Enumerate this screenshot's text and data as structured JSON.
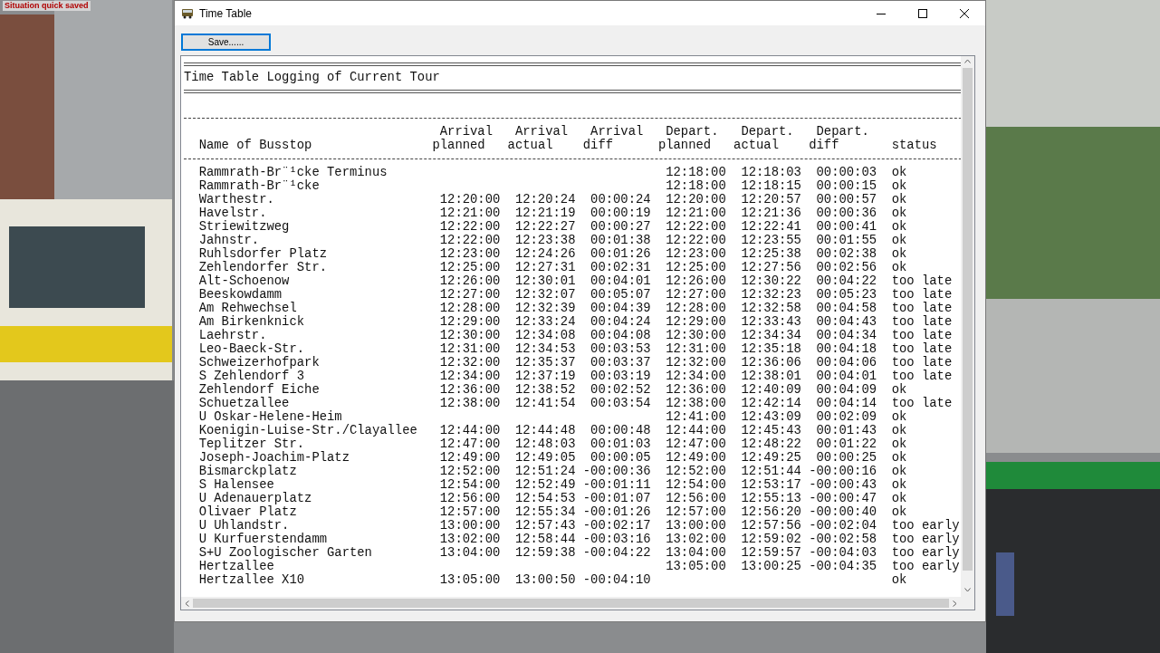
{
  "overlay_message": "Situation quick saved",
  "window": {
    "title": "Time Table"
  },
  "toolbar": {
    "save_button": "Save......"
  },
  "log": {
    "title": "Time Table Logging of Current Tour",
    "name_header": "Name of Busstop",
    "columns": [
      {
        "line1": "Arrival",
        "line2": "planned"
      },
      {
        "line1": "Arrival",
        "line2": "actual"
      },
      {
        "line1": "Arrival",
        "line2": "diff"
      },
      {
        "line1": "Depart.",
        "line2": "planned"
      },
      {
        "line1": "Depart.",
        "line2": "actual"
      },
      {
        "line1": "Depart.",
        "line2": "diff"
      }
    ],
    "status_header": "status",
    "rows": [
      {
        "name": "Rammrath-Br¨¹cke Terminus",
        "departure_planned": "12:18:00",
        "departure_actual": "12:18:03",
        "departure_diff": "00:00:03",
        "status": "ok"
      },
      {
        "name": "Rammrath-Br¨¹cke",
        "departure_planned": "12:18:00",
        "departure_actual": "12:18:15",
        "departure_diff": "00:00:15",
        "status": "ok"
      },
      {
        "name": "Warthestr.",
        "arrival_planned": "12:20:00",
        "arrival_actual": "12:20:24",
        "arrival_diff": "00:00:24",
        "departure_planned": "12:20:00",
        "departure_actual": "12:20:57",
        "departure_diff": "00:00:57",
        "status": "ok"
      },
      {
        "name": "Havelstr.",
        "arrival_planned": "12:21:00",
        "arrival_actual": "12:21:19",
        "arrival_diff": "00:00:19",
        "departure_planned": "12:21:00",
        "departure_actual": "12:21:36",
        "departure_diff": "00:00:36",
        "status": "ok"
      },
      {
        "name": "Striewitzweg",
        "arrival_planned": "12:22:00",
        "arrival_actual": "12:22:27",
        "arrival_diff": "00:00:27",
        "departure_planned": "12:22:00",
        "departure_actual": "12:22:41",
        "departure_diff": "00:00:41",
        "status": "ok"
      },
      {
        "name": "Jahnstr.",
        "arrival_planned": "12:22:00",
        "arrival_actual": "12:23:38",
        "arrival_diff": "00:01:38",
        "departure_planned": "12:22:00",
        "departure_actual": "12:23:55",
        "departure_diff": "00:01:55",
        "status": "ok"
      },
      {
        "name": "Ruhlsdorfer Platz",
        "arrival_planned": "12:23:00",
        "arrival_actual": "12:24:26",
        "arrival_diff": "00:01:26",
        "departure_planned": "12:23:00",
        "departure_actual": "12:25:38",
        "departure_diff": "00:02:38",
        "status": "ok"
      },
      {
        "name": "Zehlendorfer Str.",
        "arrival_planned": "12:25:00",
        "arrival_actual": "12:27:31",
        "arrival_diff": "00:02:31",
        "departure_planned": "12:25:00",
        "departure_actual": "12:27:56",
        "departure_diff": "00:02:56",
        "status": "ok"
      },
      {
        "name": "Alt-Schoenow",
        "arrival_planned": "12:26:00",
        "arrival_actual": "12:30:01",
        "arrival_diff": "00:04:01",
        "departure_planned": "12:26:00",
        "departure_actual": "12:30:22",
        "departure_diff": "00:04:22",
        "status": "too late"
      },
      {
        "name": "Beeskowdamm",
        "arrival_planned": "12:27:00",
        "arrival_actual": "12:32:07",
        "arrival_diff": "00:05:07",
        "departure_planned": "12:27:00",
        "departure_actual": "12:32:23",
        "departure_diff": "00:05:23",
        "status": "too late"
      },
      {
        "name": "Am Rehwechsel",
        "arrival_planned": "12:28:00",
        "arrival_actual": "12:32:39",
        "arrival_diff": "00:04:39",
        "departure_planned": "12:28:00",
        "departure_actual": "12:32:58",
        "departure_diff": "00:04:58",
        "status": "too late"
      },
      {
        "name": "Am Birkenknick",
        "arrival_planned": "12:29:00",
        "arrival_actual": "12:33:24",
        "arrival_diff": "00:04:24",
        "departure_planned": "12:29:00",
        "departure_actual": "12:33:43",
        "departure_diff": "00:04:43",
        "status": "too late"
      },
      {
        "name": "Laehrstr.",
        "arrival_planned": "12:30:00",
        "arrival_actual": "12:34:08",
        "arrival_diff": "00:04:08",
        "departure_planned": "12:30:00",
        "departure_actual": "12:34:34",
        "departure_diff": "00:04:34",
        "status": "too late"
      },
      {
        "name": "Leo-Baeck-Str.",
        "arrival_planned": "12:31:00",
        "arrival_actual": "12:34:53",
        "arrival_diff": "00:03:53",
        "departure_planned": "12:31:00",
        "departure_actual": "12:35:18",
        "departure_diff": "00:04:18",
        "status": "too late"
      },
      {
        "name": "Schweizerhofpark",
        "arrival_planned": "12:32:00",
        "arrival_actual": "12:35:37",
        "arrival_diff": "00:03:37",
        "departure_planned": "12:32:00",
        "departure_actual": "12:36:06",
        "departure_diff": "00:04:06",
        "status": "too late"
      },
      {
        "name": "S Zehlendorf 3",
        "arrival_planned": "12:34:00",
        "arrival_actual": "12:37:19",
        "arrival_diff": "00:03:19",
        "departure_planned": "12:34:00",
        "departure_actual": "12:38:01",
        "departure_diff": "00:04:01",
        "status": "too late"
      },
      {
        "name": "Zehlendorf Eiche",
        "arrival_planned": "12:36:00",
        "arrival_actual": "12:38:52",
        "arrival_diff": "00:02:52",
        "departure_planned": "12:36:00",
        "departure_actual": "12:40:09",
        "departure_diff": "00:04:09",
        "status": "ok"
      },
      {
        "name": "Schuetzallee",
        "arrival_planned": "12:38:00",
        "arrival_actual": "12:41:54",
        "arrival_diff": "00:03:54",
        "departure_planned": "12:38:00",
        "departure_actual": "12:42:14",
        "departure_diff": "00:04:14",
        "status": "too late"
      },
      {
        "name": "U Oskar-Helene-Heim",
        "departure_planned": "12:41:00",
        "departure_actual": "12:43:09",
        "departure_diff": "00:02:09",
        "status": "ok"
      },
      {
        "name": "Koenigin-Luise-Str./Clayallee",
        "arrival_planned": "12:44:00",
        "arrival_actual": "12:44:48",
        "arrival_diff": "00:00:48",
        "departure_planned": "12:44:00",
        "departure_actual": "12:45:43",
        "departure_diff": "00:01:43",
        "status": "ok"
      },
      {
        "name": "Teplitzer Str.",
        "arrival_planned": "12:47:00",
        "arrival_actual": "12:48:03",
        "arrival_diff": "00:01:03",
        "departure_planned": "12:47:00",
        "departure_actual": "12:48:22",
        "departure_diff": "00:01:22",
        "status": "ok"
      },
      {
        "name": "Joseph-Joachim-Platz",
        "arrival_planned": "12:49:00",
        "arrival_actual": "12:49:05",
        "arrival_diff": "00:00:05",
        "departure_planned": "12:49:00",
        "departure_actual": "12:49:25",
        "departure_diff": "00:00:25",
        "status": "ok"
      },
      {
        "name": "Bismarckplatz",
        "arrival_planned": "12:52:00",
        "arrival_actual": "12:51:24",
        "arrival_diff": "-00:00:36",
        "departure_planned": "12:52:00",
        "departure_actual": "12:51:44",
        "departure_diff": "-00:00:16",
        "status": "ok"
      },
      {
        "name": "S Halensee",
        "arrival_planned": "12:54:00",
        "arrival_actual": "12:52:49",
        "arrival_diff": "-00:01:11",
        "departure_planned": "12:54:00",
        "departure_actual": "12:53:17",
        "departure_diff": "-00:00:43",
        "status": "ok"
      },
      {
        "name": "U Adenauerplatz",
        "arrival_planned": "12:56:00",
        "arrival_actual": "12:54:53",
        "arrival_diff": "-00:01:07",
        "departure_planned": "12:56:00",
        "departure_actual": "12:55:13",
        "departure_diff": "-00:00:47",
        "status": "ok"
      },
      {
        "name": "Olivaer Platz",
        "arrival_planned": "12:57:00",
        "arrival_actual": "12:55:34",
        "arrival_diff": "-00:01:26",
        "departure_planned": "12:57:00",
        "departure_actual": "12:56:20",
        "departure_diff": "-00:00:40",
        "status": "ok"
      },
      {
        "name": "U Uhlandstr.",
        "arrival_planned": "13:00:00",
        "arrival_actual": "12:57:43",
        "arrival_diff": "-00:02:17",
        "departure_planned": "13:00:00",
        "departure_actual": "12:57:56",
        "departure_diff": "-00:02:04",
        "status": "too early"
      },
      {
        "name": "U Kurfuerstendamm",
        "arrival_planned": "13:02:00",
        "arrival_actual": "12:58:44",
        "arrival_diff": "-00:03:16",
        "departure_planned": "13:02:00",
        "departure_actual": "12:59:02",
        "departure_diff": "-00:02:58",
        "status": "too early"
      },
      {
        "name": "S+U Zoologischer Garten",
        "arrival_planned": "13:04:00",
        "arrival_actual": "12:59:38",
        "arrival_diff": "-00:04:22",
        "departure_planned": "13:04:00",
        "departure_actual": "12:59:57",
        "departure_diff": "-00:04:03",
        "status": "too early"
      },
      {
        "name": "Hertzallee",
        "departure_planned": "13:05:00",
        "departure_actual": "13:00:25",
        "departure_diff": "-00:04:35",
        "status": "too early"
      },
      {
        "name": "Hertzallee X10",
        "arrival_planned": "13:05:00",
        "arrival_actual": "13:00:50",
        "arrival_diff": "-00:04:10",
        "status": "ok"
      }
    ]
  }
}
